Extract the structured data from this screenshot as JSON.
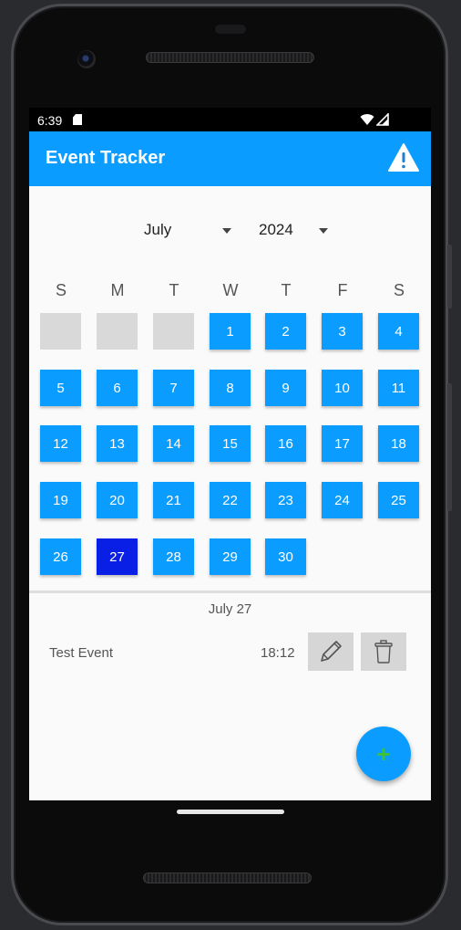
{
  "status_bar": {
    "time": "6:39"
  },
  "app_bar": {
    "title": "Event Tracker",
    "alert_icon": "warning-triangle-icon"
  },
  "calendar": {
    "month": "July",
    "year": "2024",
    "weekday_headers": [
      "S",
      "M",
      "T",
      "W",
      "T",
      "F",
      "S"
    ],
    "leading_empty_days": 3,
    "days": [
      "1",
      "2",
      "3",
      "4",
      "5",
      "6",
      "7",
      "8",
      "9",
      "10",
      "11",
      "12",
      "13",
      "14",
      "15",
      "16",
      "17",
      "18",
      "19",
      "20",
      "21",
      "22",
      "23",
      "24",
      "25",
      "26",
      "27",
      "28",
      "29",
      "30"
    ],
    "selected_day": "27"
  },
  "events_section": {
    "date_heading": "July 27",
    "events": [
      {
        "title": "Test Event",
        "time": "18:12",
        "edit_icon": "pencil-icon",
        "delete_icon": "trash-icon"
      }
    ]
  },
  "fab": {
    "label": "+"
  },
  "colors": {
    "primary": "#0a9dff",
    "selected_day": "#0a1fe6",
    "empty_day": "#d9d9d9",
    "fab_plus": "#3fc23a"
  }
}
